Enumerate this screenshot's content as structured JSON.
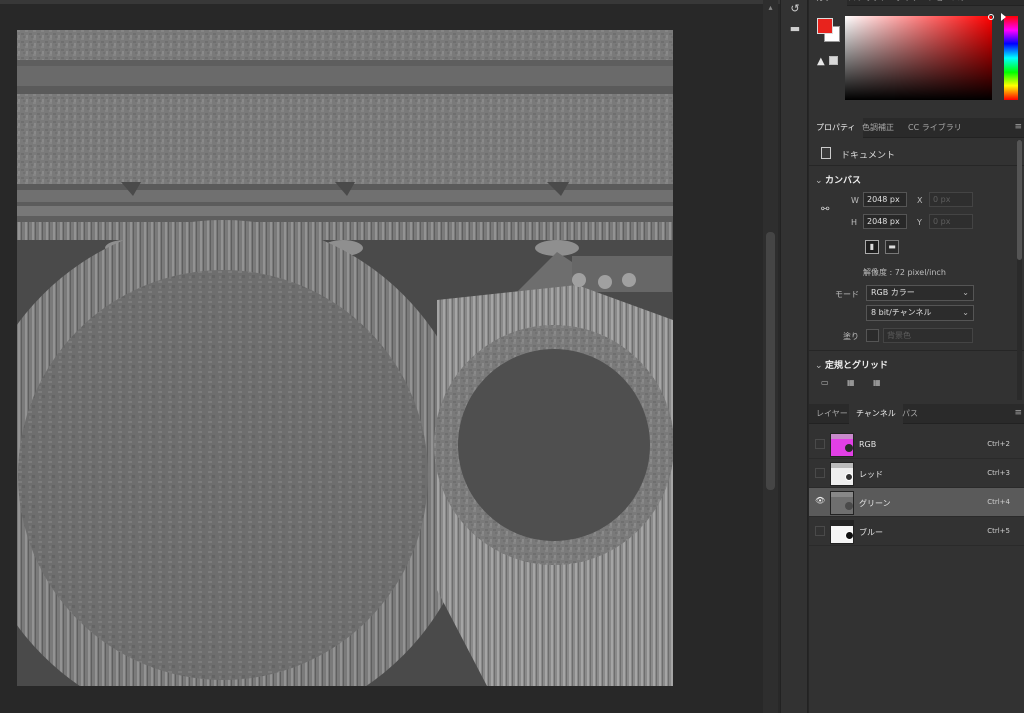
{
  "toolstrip": {
    "icons": [
      "history-icon",
      "comment-icon"
    ]
  },
  "color_panel": {
    "tabs": [
      "カラー",
      "スウォッチ",
      "グラデーション",
      "パターン"
    ],
    "foreground": "#e8231d",
    "background": "#ffffff",
    "hue": "#ff0000"
  },
  "properties": {
    "tabs": [
      "プロパティ",
      "色調補正",
      "CC ライブラリ"
    ],
    "document_label": "ドキュメント",
    "canvas_title": "カンバス",
    "w_label": "W",
    "w_value": "2048 px",
    "h_label": "H",
    "h_value": "2048 px",
    "x_label": "X",
    "x_placeholder": "0 px",
    "y_label": "Y",
    "y_placeholder": "0 px",
    "resolution": "解像度 : 72 pixel/inch",
    "mode_label": "モード",
    "mode_value": "RGB カラー",
    "bit_value": "8 bit/チャンネル",
    "fill_label": "塗り",
    "fill_value": "背景色",
    "guides_title": "定規とグリッド"
  },
  "channels_panel": {
    "tabs": [
      "レイヤー",
      "チャンネル",
      "パス"
    ],
    "channels": [
      {
        "name": "RGB",
        "shortcut": "Ctrl+2",
        "visible": false
      },
      {
        "name": "レッド",
        "shortcut": "Ctrl+3",
        "visible": false
      },
      {
        "name": "グリーン",
        "shortcut": "Ctrl+4",
        "visible": true
      },
      {
        "name": "ブルー",
        "shortcut": "Ctrl+5",
        "visible": false
      }
    ]
  }
}
